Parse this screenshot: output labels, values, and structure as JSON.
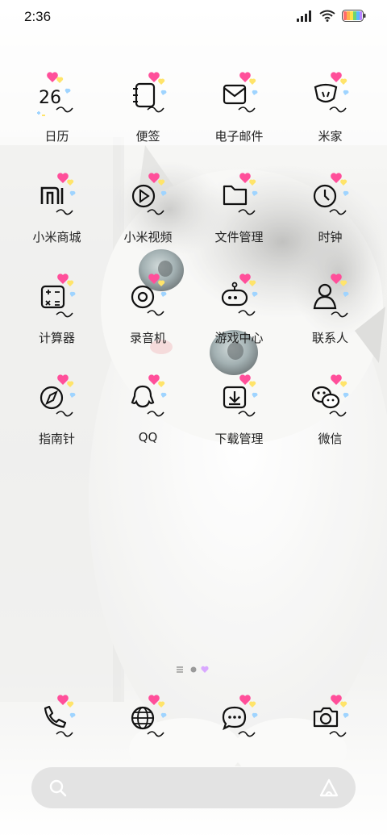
{
  "status_bar": {
    "time": "2:36"
  },
  "apps": [
    {
      "label": "日历",
      "icon": "calendar-icon",
      "day": "26"
    },
    {
      "label": "便签",
      "icon": "notes-icon"
    },
    {
      "label": "电子邮件",
      "icon": "mail-icon"
    },
    {
      "label": "米家",
      "icon": "mijia-icon"
    },
    {
      "label": "小米商城",
      "icon": "mi-store-icon"
    },
    {
      "label": "小米视频",
      "icon": "video-icon"
    },
    {
      "label": "文件管理",
      "icon": "folder-icon"
    },
    {
      "label": "时钟",
      "icon": "clock-icon"
    },
    {
      "label": "计算器",
      "icon": "calculator-icon"
    },
    {
      "label": "录音机",
      "icon": "recorder-icon"
    },
    {
      "label": "游戏中心",
      "icon": "game-center-icon"
    },
    {
      "label": "联系人",
      "icon": "contacts-icon"
    },
    {
      "label": "指南针",
      "icon": "compass-icon"
    },
    {
      "label": "QQ",
      "icon": "qq-icon"
    },
    {
      "label": "下载管理",
      "icon": "download-icon"
    },
    {
      "label": "微信",
      "icon": "wechat-icon"
    }
  ],
  "dock": [
    {
      "icon": "phone-icon"
    },
    {
      "icon": "browser-icon"
    },
    {
      "icon": "messages-icon"
    },
    {
      "icon": "camera-icon"
    }
  ],
  "page_indicator": {
    "pages": 3,
    "current": 2
  },
  "colors": {
    "heart": "#ff4f9a",
    "heart_yellow": "#ffe46a",
    "heart_blue": "#9fd4ff",
    "lavender": "#d9a8ff"
  }
}
